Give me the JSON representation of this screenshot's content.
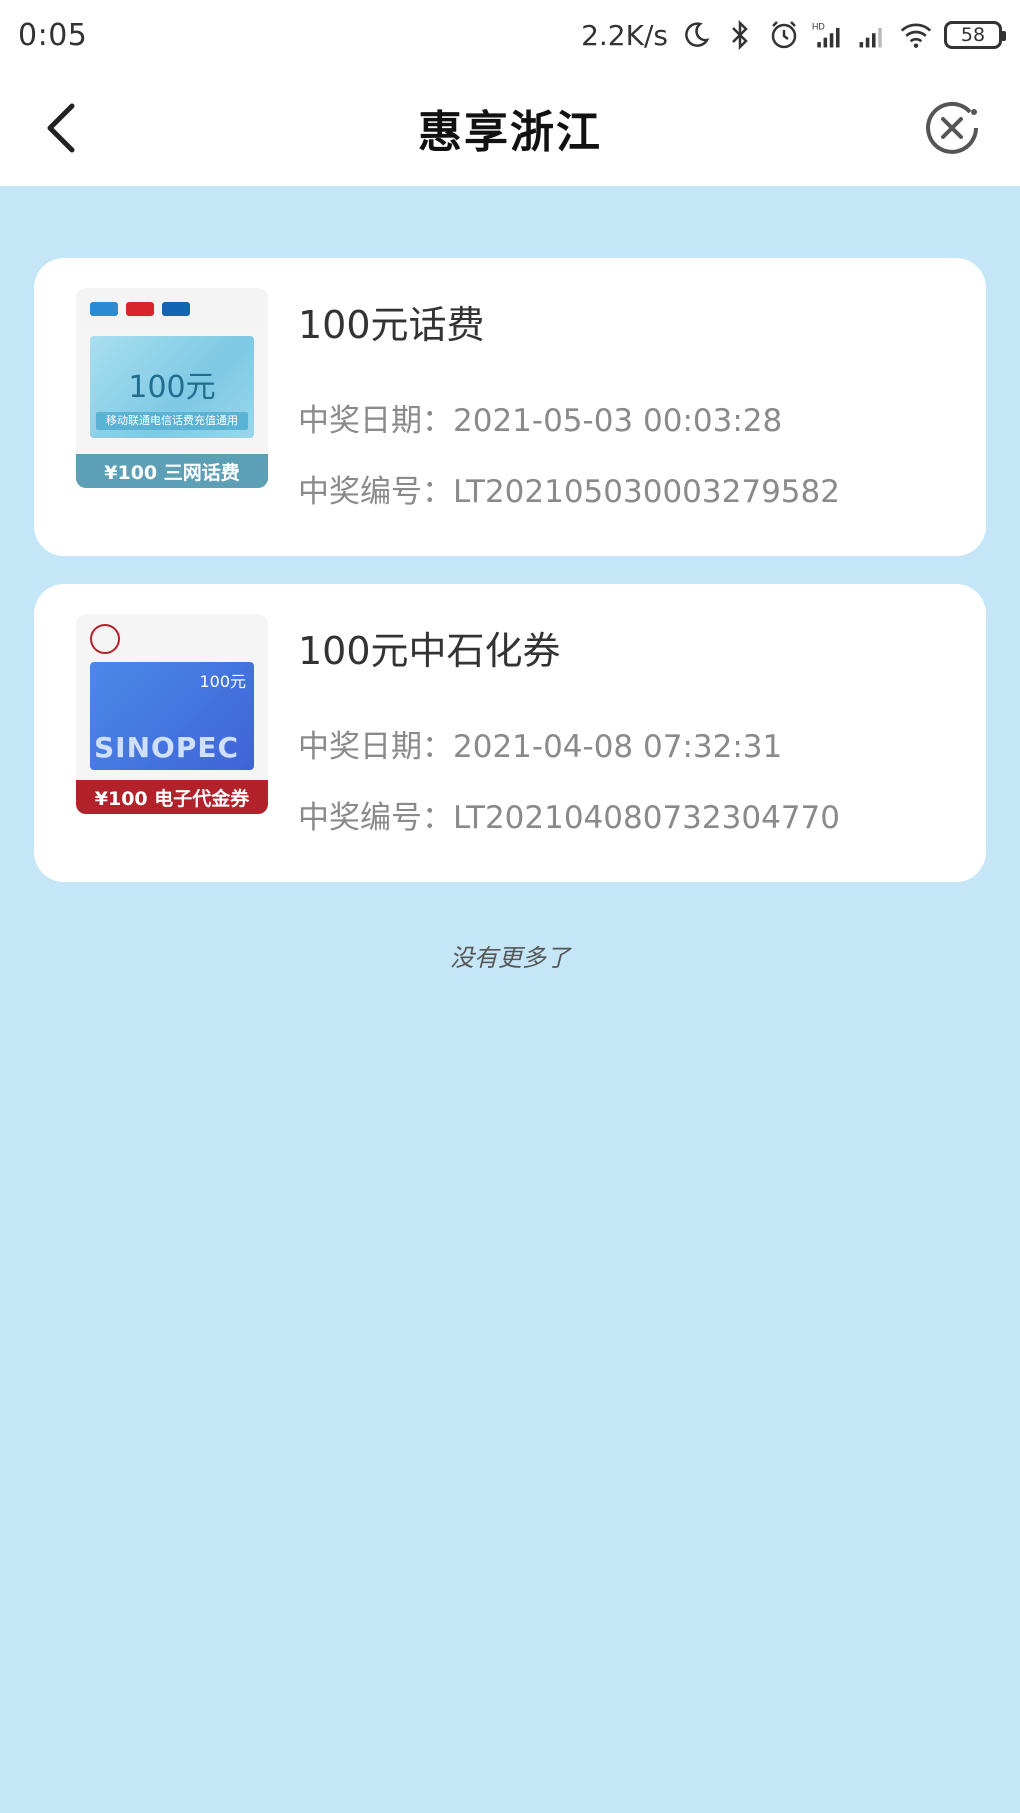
{
  "status_bar": {
    "time": "0:05",
    "net_speed": "2.2K/s",
    "battery": "58",
    "icons": [
      "moon-icon",
      "bluetooth-icon",
      "alarm-icon",
      "hd-signal-icon",
      "signal-icon",
      "wifi-icon",
      "battery-icon"
    ]
  },
  "nav": {
    "title": "惠享浙江",
    "back_icon": "chevron-left-icon",
    "close_icon": "close-circle-icon"
  },
  "prizes": [
    {
      "title": "100元话费",
      "date_label": "中奖日期：",
      "date": "2021-05-03 00:03:28",
      "id_label": "中奖编号：",
      "id": "LT2021050300032795​82",
      "thumb": {
        "amount": "100元",
        "sub": "移动联通电信话费充值通用",
        "strip": "¥100 三网话费",
        "colors": {
          "card": "#7ec9e4",
          "strip": "#5da0b6"
        }
      }
    },
    {
      "title": "100元中石化券",
      "date_label": "中奖日期：",
      "date": "2021-04-08 07:32:31",
      "id_label": "中奖编号：",
      "id": "LT2021040807323047​70",
      "thumb": {
        "amount": "100元",
        "brand": "SINOPEC",
        "strip": "¥100 电子代金券",
        "colors": {
          "card": "#3f63d6",
          "strip": "#b3222a"
        }
      }
    }
  ],
  "footer": {
    "no_more": "没有更多了"
  }
}
